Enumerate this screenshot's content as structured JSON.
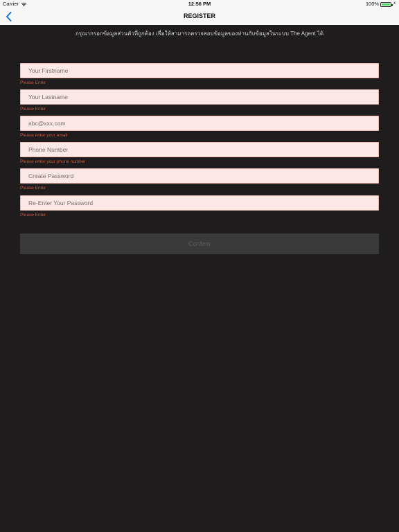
{
  "status_bar": {
    "carrier": "Carrier",
    "time": "12:56 PM",
    "battery": "100%"
  },
  "nav": {
    "title": "REGISTER",
    "back_icon": "chevron-left-icon"
  },
  "instruction": "กรุณากรอกข้อมูลส่วนตัวที่ถูกต้อง เพื่อให้สามารถตรวจสอบข้อมูลของท่านกับข้อมูลในระบบ The Agent ได้",
  "fields": [
    {
      "placeholder": "Your Firstname",
      "error": "Please Enter"
    },
    {
      "placeholder": "Your Lastname",
      "error": "Please Enter"
    },
    {
      "placeholder": "abc@xxx.com",
      "error": "Please enter your email"
    },
    {
      "placeholder": "Phone Number",
      "error": "Please enter your phone number"
    },
    {
      "placeholder": "Create Password",
      "error": "Please Enter"
    },
    {
      "placeholder": "Re-Enter Your Password",
      "error": "Please Enter"
    }
  ],
  "confirm_label": "Confirm",
  "colors": {
    "background": "#1e1c1c",
    "field_background": "#fde8e6",
    "error_text": "#c8553f",
    "accent_blue": "#1a73e8",
    "battery_green": "#4cd964"
  }
}
